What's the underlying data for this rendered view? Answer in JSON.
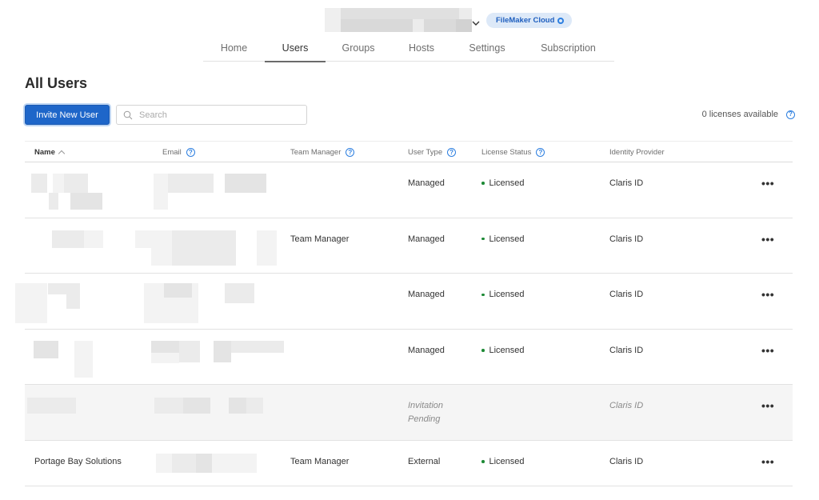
{
  "header": {
    "account_name_redacted": true,
    "product_badge": "FileMaker Cloud"
  },
  "tabs": [
    {
      "label": "Home",
      "active": false
    },
    {
      "label": "Users",
      "active": true
    },
    {
      "label": "Groups",
      "active": false
    },
    {
      "label": "Hosts",
      "active": false
    },
    {
      "label": "Settings",
      "active": false
    },
    {
      "label": "Subscription",
      "active": false
    }
  ],
  "page": {
    "title": "All Users"
  },
  "toolbar": {
    "invite_label": "Invite New User",
    "search_placeholder": "Search",
    "search_value": "",
    "licenses_text": "0 licenses available",
    "help_glyph": "?"
  },
  "table": {
    "columns": {
      "name": "Name",
      "email": "Email",
      "team_manager": "Team Manager",
      "user_type": "User Type",
      "license_status": "License Status",
      "identity_provider": "Identity Provider"
    },
    "sort": {
      "column": "name",
      "direction": "ascending"
    },
    "rows": [
      {
        "name": "",
        "email": "",
        "team_manager": "",
        "user_type": "Managed",
        "license_status": "Licensed",
        "identity_provider": "Claris ID",
        "pending": false,
        "redacted": true
      },
      {
        "name": "",
        "email": "",
        "team_manager": "Team Manager",
        "user_type": "Managed",
        "license_status": "Licensed",
        "identity_provider": "Claris ID",
        "pending": false,
        "redacted": true
      },
      {
        "name": "",
        "email": "",
        "team_manager": "",
        "user_type": "Managed",
        "license_status": "Licensed",
        "identity_provider": "Claris ID",
        "pending": false,
        "redacted": true
      },
      {
        "name": "",
        "email": "",
        "team_manager": "",
        "user_type": "Managed",
        "license_status": "Licensed",
        "identity_provider": "Claris ID",
        "pending": false,
        "redacted": true
      },
      {
        "name": "",
        "email": "",
        "team_manager": "",
        "user_type": "Invitation Pending",
        "license_status": "",
        "identity_provider": "Claris ID",
        "pending": true,
        "redacted": true
      },
      {
        "name": "Portage Bay Solutions",
        "email": "",
        "team_manager": "Team Manager",
        "user_type": "External",
        "license_status": "Licensed",
        "identity_provider": "Claris ID",
        "pending": false,
        "redacted": true
      }
    ],
    "more_glyph": "•••"
  },
  "colors": {
    "primary": "#1e66c9",
    "licensed_dot": "#1e8a36",
    "badge_bg": "#dde9f8",
    "badge_text": "#1f5fbf",
    "pending_row_bg": "#f5f5f5"
  }
}
